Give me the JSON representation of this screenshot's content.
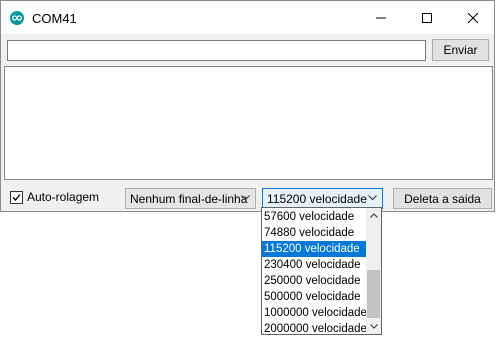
{
  "window": {
    "title": "COM41",
    "icon": "arduino-icon",
    "accent": "#00979c"
  },
  "send": {
    "input_value": "",
    "button_label": "Enviar"
  },
  "output": {
    "text": ""
  },
  "footer": {
    "autoscroll_label": "Auto-rolagem",
    "autoscroll_checked": true,
    "line_ending_selected": "Nenhum final-de-linha",
    "baud_selected": "115200 velocidade",
    "clear_label": "Deleta a saida"
  },
  "baud_dropdown": {
    "items": [
      "57600 velocidade",
      "74880 velocidade",
      "115200 velocidade",
      "230400 velocidade",
      "250000 velocidade",
      "500000 velocidade",
      "1000000 velocidade",
      "2000000 velocidade"
    ],
    "selected_index": 2,
    "selection_color": "#0078d7"
  }
}
